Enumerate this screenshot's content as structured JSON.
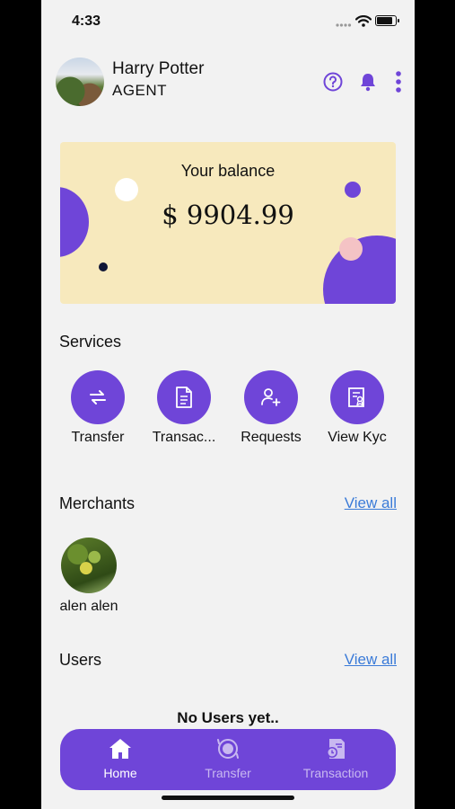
{
  "status_bar": {
    "time": "4:33",
    "battery_level": 0.9
  },
  "header": {
    "user_name": "Harry Potter",
    "user_role": "AGENT",
    "icons": [
      "help-icon",
      "bell-icon",
      "more-vertical-icon"
    ]
  },
  "balance": {
    "label": "Your balance",
    "amount": "$ 9904.99"
  },
  "services": {
    "title": "Services",
    "items": [
      {
        "label": "Transfer",
        "icon": "transfer-arrows-icon"
      },
      {
        "label": "Transac...",
        "icon": "document-icon"
      },
      {
        "label": "Requests",
        "icon": "user-add-icon"
      },
      {
        "label": "View Kyc",
        "icon": "id-card-icon"
      }
    ]
  },
  "merchants": {
    "title": "Merchants",
    "view_all": "View all",
    "items": [
      {
        "name": "alen alen"
      }
    ]
  },
  "users": {
    "title": "Users",
    "view_all": "View all",
    "empty_text": "No Users yet.."
  },
  "bottom_nav": {
    "items": [
      {
        "label": "Home",
        "icon": "home-icon",
        "active": true
      },
      {
        "label": "Transfer",
        "icon": "transfer-coin-icon",
        "active": false
      },
      {
        "label": "Transaction",
        "icon": "transaction-clock-icon",
        "active": false
      }
    ]
  },
  "colors": {
    "accent": "#6f45d8",
    "card_bg": "#f7e9bd",
    "link": "#3b7bd8",
    "page_bg": "#f2f2f2",
    "nav_inactive": "#c8b8f0"
  }
}
